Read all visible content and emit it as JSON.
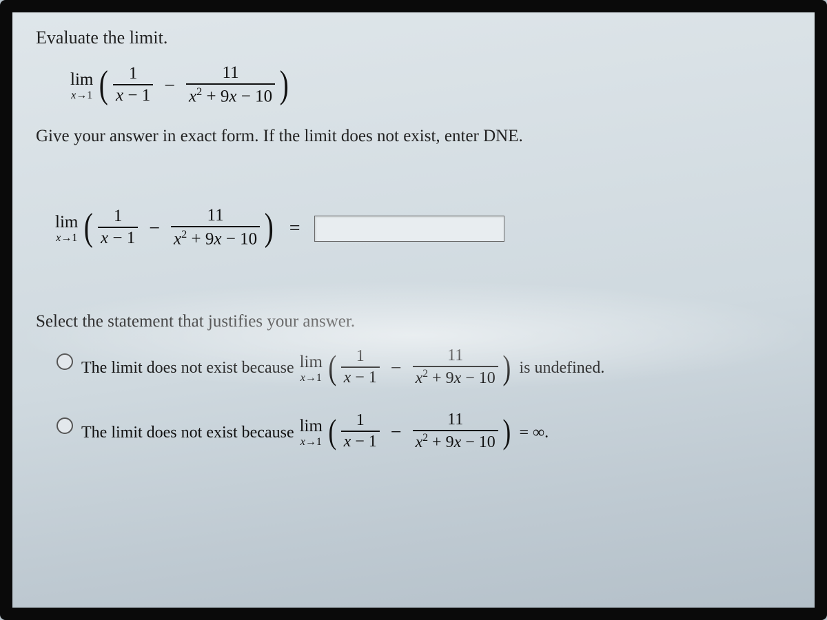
{
  "prompt": "Evaluate the limit.",
  "instruction": "Give your answer in exact form. If the limit does not exist, enter DNE.",
  "select_statement": "Select the statement that justifies your answer.",
  "math": {
    "lim_top": "lim",
    "lim_bot": "x→1",
    "frac1_num": "1",
    "frac1_den": "x − 1",
    "minus": "−",
    "frac2_num": "11",
    "frac2_den": "x² + 9x − 10",
    "equals": "="
  },
  "answer_placeholder": "",
  "options": {
    "opt1_pre": "The limit does not exist because ",
    "opt1_post": " is undefined.",
    "opt2_pre": "The limit does not exist because ",
    "opt2_post": " = ∞."
  }
}
